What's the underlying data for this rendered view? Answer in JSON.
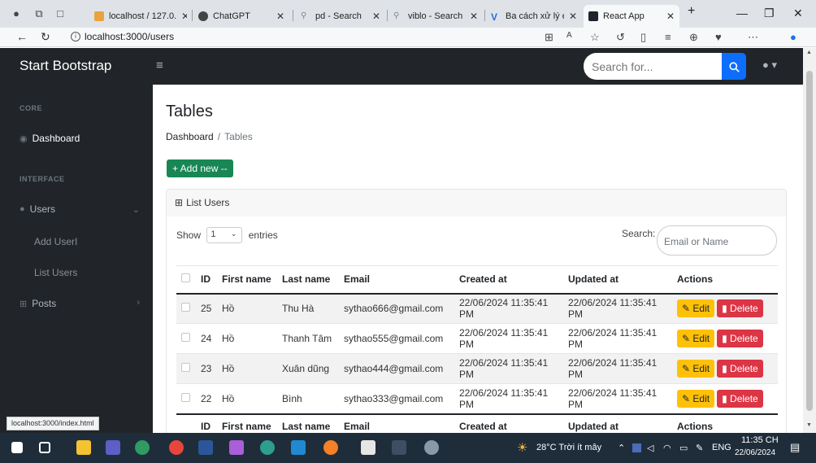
{
  "browser": {
    "tabs": [
      {
        "label": "localhost / 127.0.",
        "color": "#e8a33d",
        "active": false
      },
      {
        "label": "ChatGPT",
        "color": "#444444",
        "active": false
      },
      {
        "label": "pd - Search",
        "color": "#9aa7b5",
        "active": false
      },
      {
        "label": "viblo - Search",
        "color": "#9aa7b5",
        "active": false
      },
      {
        "label": "Ba cách xử lý eve",
        "color": "#2b6de8",
        "active": false
      },
      {
        "label": "React App",
        "color": "#20232a",
        "active": true
      }
    ],
    "new_tab": "+",
    "url": "localhost:3000/users",
    "status_url": "localhost:3000/index.html"
  },
  "navbar": {
    "brand": "Start Bootstrap",
    "search_placeholder": "Search for..."
  },
  "sidebar": {
    "heading_core": "CORE",
    "dashboard": "Dashboard",
    "heading_interface": "INTERFACE",
    "users": "Users",
    "add_user": "Add UserI",
    "list_users": "List Users",
    "posts": "Posts"
  },
  "main": {
    "title": "Tables",
    "breadcrumb": {
      "home": "Dashboard",
      "separator": "/",
      "current": "Tables"
    },
    "add_button": "+ Add new --",
    "card_header": "List Users",
    "show_label": "Show",
    "show_value": "1",
    "entries_label": "entries",
    "search_label": "Search:",
    "search_placeholder": "Email or Name"
  },
  "table": {
    "headers": [
      "ID",
      "First name",
      "Last name",
      "Email",
      "Created at",
      "Updated at",
      "Actions"
    ],
    "rows": [
      {
        "id": "25",
        "first": "Hồ",
        "last": "Thu Hà",
        "email": "sythao666@gmail.com",
        "created": "22/06/2024 11:35:41 PM",
        "updated": "22/06/2024 11:35:41 PM"
      },
      {
        "id": "24",
        "first": "Hồ",
        "last": "Thanh Tâm",
        "email": "sythao555@gmail.com",
        "created": "22/06/2024 11:35:41 PM",
        "updated": "22/06/2024 11:35:41 PM"
      },
      {
        "id": "23",
        "first": "Hồ",
        "last": "Xuân dũng",
        "email": "sythao444@gmail.com",
        "created": "22/06/2024 11:35:41 PM",
        "updated": "22/06/2024 11:35:41 PM"
      },
      {
        "id": "22",
        "first": "Hồ",
        "last": "Bình",
        "email": "sythao333@gmail.com",
        "created": "22/06/2024 11:35:41 PM",
        "updated": "22/06/2024 11:35:41 PM"
      }
    ],
    "edit_label": "Edit",
    "delete_label": "Delete"
  },
  "taskbar": {
    "weather": "28°C  Trời ít mây",
    "language": "ENG",
    "time": "11:35 CH",
    "date": "22/06/2024"
  },
  "colors": {
    "navbar_bg": "#212529",
    "primary": "#0d6efd",
    "success": "#198754",
    "warning": "#ffc107",
    "danger": "#dc3545"
  }
}
